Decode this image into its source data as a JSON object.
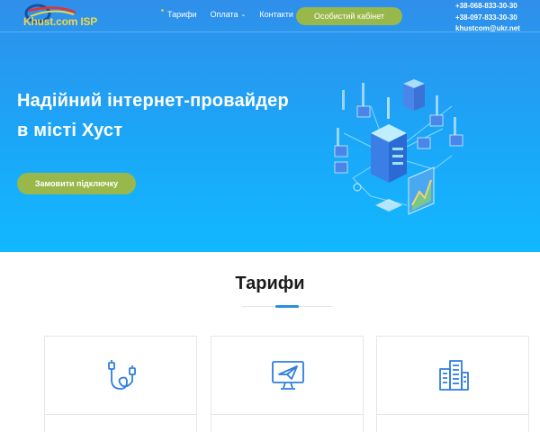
{
  "brand": {
    "name": "Khust.com ISP"
  },
  "nav": {
    "items": [
      {
        "label": "Тарифи",
        "active": true
      },
      {
        "label": "Оплата",
        "has_dropdown": true
      },
      {
        "label": "Контакти"
      }
    ],
    "cabinet_label": "Особистий кабінет"
  },
  "contacts": {
    "phone1": "+38-068-833-30-30",
    "phone2": "+38-097-833-30-30",
    "email": "khustcom@ukr.net"
  },
  "hero": {
    "line1": "Надійний інтернет-провайдер",
    "line2": "в місті Хуст",
    "cta_label": "Замовити підключку"
  },
  "tariffs": {
    "title": "Тарифи",
    "cards": [
      {
        "icon": "network-cable-icon"
      },
      {
        "icon": "monitor-paper-plane-icon"
      },
      {
        "icon": "buildings-icon"
      }
    ]
  },
  "colors": {
    "accent_green": "#98b84c",
    "hero_blue": "#1ba6f8",
    "title_accent": "#2a8fdf",
    "logo_yellow": "#f0d64a"
  }
}
